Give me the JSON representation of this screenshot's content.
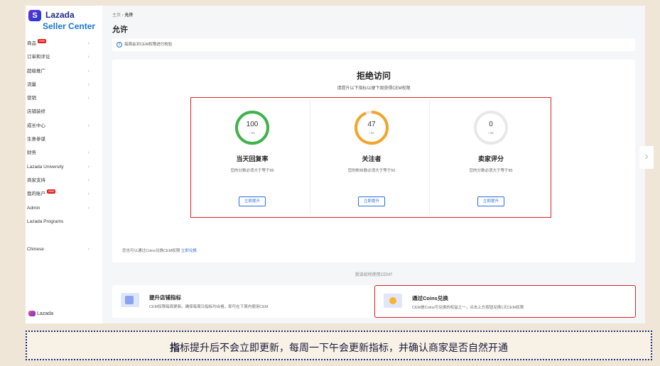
{
  "logo": {
    "name": "Lazada",
    "sub": "Seller Center",
    "mark": "S"
  },
  "sidebar": {
    "items": [
      {
        "label": "商品",
        "badge": "new",
        "chevron": true
      },
      {
        "label": "订单和评论",
        "chevron": true
      },
      {
        "label": "超级推广",
        "chevron": true
      },
      {
        "label": "流量",
        "chevron": true
      },
      {
        "label": "营销",
        "chevron": true
      },
      {
        "label": "店铺装修",
        "chevron": false
      },
      {
        "label": "成长中心",
        "chevron": true
      },
      {
        "label": "生意参谋",
        "chevron": false
      },
      {
        "label": "财务",
        "chevron": true
      },
      {
        "label": "Lazada University",
        "chevron": true
      },
      {
        "label": "商家支持",
        "chevron": true
      },
      {
        "label": "我的账户",
        "badge": "new",
        "chevron": true
      },
      {
        "label": "Admin",
        "chevron": true
      },
      {
        "label": "Lazada Programs",
        "chevron": false
      }
    ],
    "language": "Chinese",
    "footer": "Lazada"
  },
  "breadcrumb": {
    "home": "主页",
    "sep": "›",
    "current": "允许"
  },
  "page_title": "允许",
  "notice": "每周会对CEM权限进行校验",
  "card": {
    "title": "拒绝访问",
    "subtitle": "请提升以下指标以便下周获得CEM权限",
    "metrics": [
      {
        "value": "100",
        "max": "/ 85",
        "fraction": 1.0,
        "color": "#3fb24a",
        "name": "当天回复率",
        "desc": "您的分数必须大于等于85",
        "button": "立即提升"
      },
      {
        "value": "47",
        "max": "/ 50",
        "fraction": 0.94,
        "color": "#f3a52b",
        "name": "关注者",
        "desc": "您的粉丝数必须大于等于50",
        "button": "立即提升"
      },
      {
        "value": "0",
        "max": "/ 85",
        "fraction": 0.0,
        "color": "#e8e8e8",
        "name": "卖家评分",
        "desc": "您的分数必须大于等于85",
        "button": "立即提升"
      }
    ],
    "coins_note": "您也可以通过Coins兑换CEM权限",
    "coins_link": "立即兑换"
  },
  "howto": "我该如何使用CEM?",
  "options": [
    {
      "title": "提升店铺指标",
      "desc": "CEM权限每周更新。确保每周日指标均合格，即可在下周内使用CEM"
    },
    {
      "title": "通过Coins兑换",
      "desc": "CEM是Coins可兑换的权益之一，点击上方按钮兑换1天CEM权限"
    }
  ],
  "scroll_arrow": "›",
  "banner": {
    "bold": "指",
    "rest": "标提升后不会立即更新，每周一下午会更新指标，并确认商家是否自然开通"
  }
}
